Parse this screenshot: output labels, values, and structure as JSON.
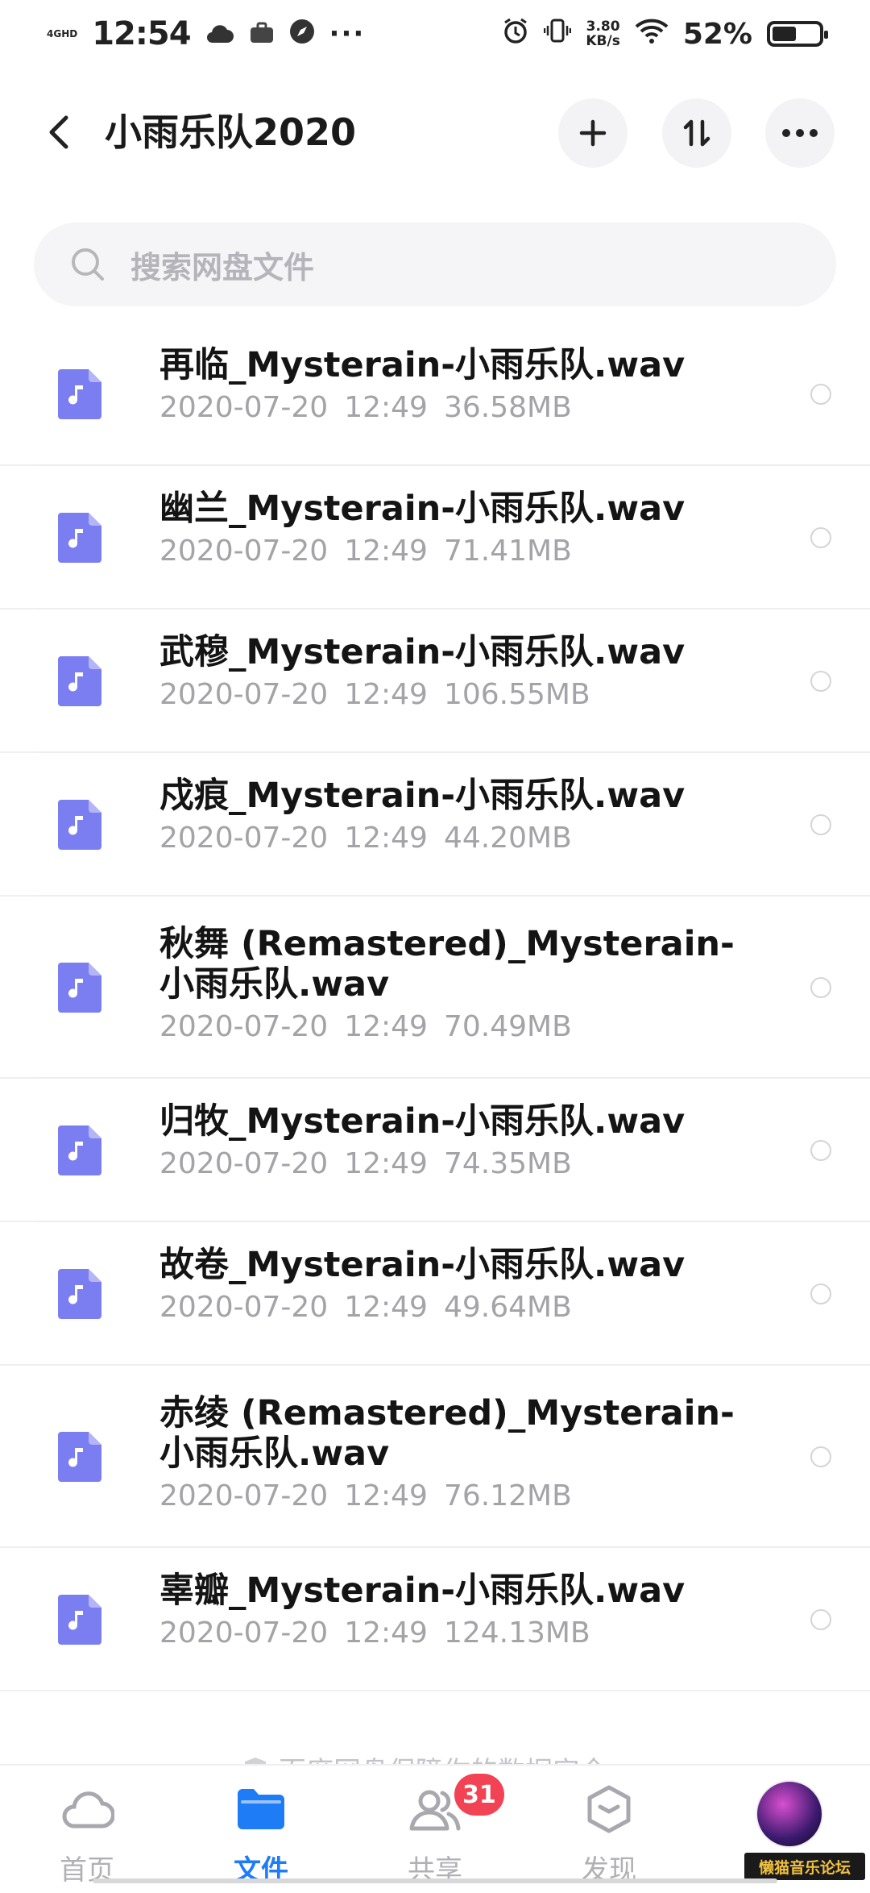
{
  "status_bar": {
    "network": "4GHD",
    "time": "12:54",
    "speed_value": "3.80",
    "speed_unit": "KB/s",
    "battery_percent_text": "52%",
    "battery_level": 0.52
  },
  "header": {
    "title": "小雨乐队2020"
  },
  "search": {
    "placeholder": "搜索网盘文件"
  },
  "files": [
    {
      "name": "再临_Mysterain-小雨乐队.wav",
      "date": "2020-07-20",
      "time": "12:49",
      "size": "36.58MB"
    },
    {
      "name": "幽兰_Mysterain-小雨乐队.wav",
      "date": "2020-07-20",
      "time": "12:49",
      "size": "71.41MB"
    },
    {
      "name": "武穆_Mysterain-小雨乐队.wav",
      "date": "2020-07-20",
      "time": "12:49",
      "size": "106.55MB"
    },
    {
      "name": "戍痕_Mysterain-小雨乐队.wav",
      "date": "2020-07-20",
      "time": "12:49",
      "size": "44.20MB"
    },
    {
      "name": "秋舞 (Remastered)_Mysterain-小雨乐队.wav",
      "date": "2020-07-20",
      "time": "12:49",
      "size": "70.49MB"
    },
    {
      "name": "归牧_Mysterain-小雨乐队.wav",
      "date": "2020-07-20",
      "time": "12:49",
      "size": "74.35MB"
    },
    {
      "name": "故卷_Mysterain-小雨乐队.wav",
      "date": "2020-07-20",
      "time": "12:49",
      "size": "49.64MB"
    },
    {
      "name": "赤绫 (Remastered)_Mysterain-小雨乐队.wav",
      "date": "2020-07-20",
      "time": "12:49",
      "size": "76.12MB"
    },
    {
      "name": "辜瓣_Mysterain-小雨乐队.wav",
      "date": "2020-07-20",
      "time": "12:49",
      "size": "124.13MB"
    }
  ],
  "safety_note": "百度网盘保障你的数据安全",
  "bottom_nav": {
    "home": "首页",
    "files": "文件",
    "share": "共享",
    "share_badge": "31",
    "discover": "发现"
  },
  "watermark": "懒猫音乐论坛",
  "colors": {
    "accent": "#1e7cf7",
    "file_icon": "#7b7ef0",
    "badge": "#f24355"
  }
}
